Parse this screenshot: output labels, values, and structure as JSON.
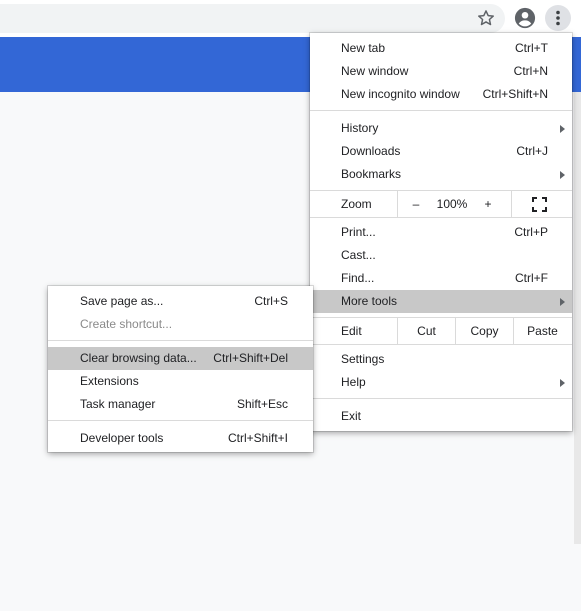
{
  "main_menu": {
    "new_tab": {
      "label": "New tab",
      "shortcut": "Ctrl+T"
    },
    "new_window": {
      "label": "New window",
      "shortcut": "Ctrl+N"
    },
    "new_incognito": {
      "label": "New incognito window",
      "shortcut": "Ctrl+Shift+N"
    },
    "history": {
      "label": "History"
    },
    "downloads": {
      "label": "Downloads",
      "shortcut": "Ctrl+J"
    },
    "bookmarks": {
      "label": "Bookmarks"
    },
    "zoom": {
      "label": "Zoom",
      "minus": "–",
      "value": "100%",
      "plus": "+"
    },
    "print": {
      "label": "Print...",
      "shortcut": "Ctrl+P"
    },
    "cast": {
      "label": "Cast..."
    },
    "find": {
      "label": "Find...",
      "shortcut": "Ctrl+F"
    },
    "more_tools": {
      "label": "More tools"
    },
    "edit": {
      "label": "Edit",
      "cut": "Cut",
      "copy": "Copy",
      "paste": "Paste"
    },
    "settings": {
      "label": "Settings"
    },
    "help": {
      "label": "Help"
    },
    "exit": {
      "label": "Exit"
    }
  },
  "more_tools_menu": {
    "save_page": {
      "label": "Save page as...",
      "shortcut": "Ctrl+S"
    },
    "create_shortcut": {
      "label": "Create shortcut..."
    },
    "clear_browsing": {
      "label": "Clear browsing data...",
      "shortcut": "Ctrl+Shift+Del"
    },
    "extensions": {
      "label": "Extensions"
    },
    "task_manager": {
      "label": "Task manager",
      "shortcut": "Shift+Esc"
    },
    "developer_tools": {
      "label": "Developer tools",
      "shortcut": "Ctrl+Shift+I"
    }
  },
  "colors": {
    "banner": "#3367d6",
    "highlight": "#c8c8c8",
    "menu_bg": "#ffffff",
    "page_bg": "#f8f9fa"
  },
  "icons": [
    "star-icon",
    "account-icon",
    "kebab-menu-icon",
    "fullscreen-icon",
    "submenu-arrow-icon"
  ]
}
